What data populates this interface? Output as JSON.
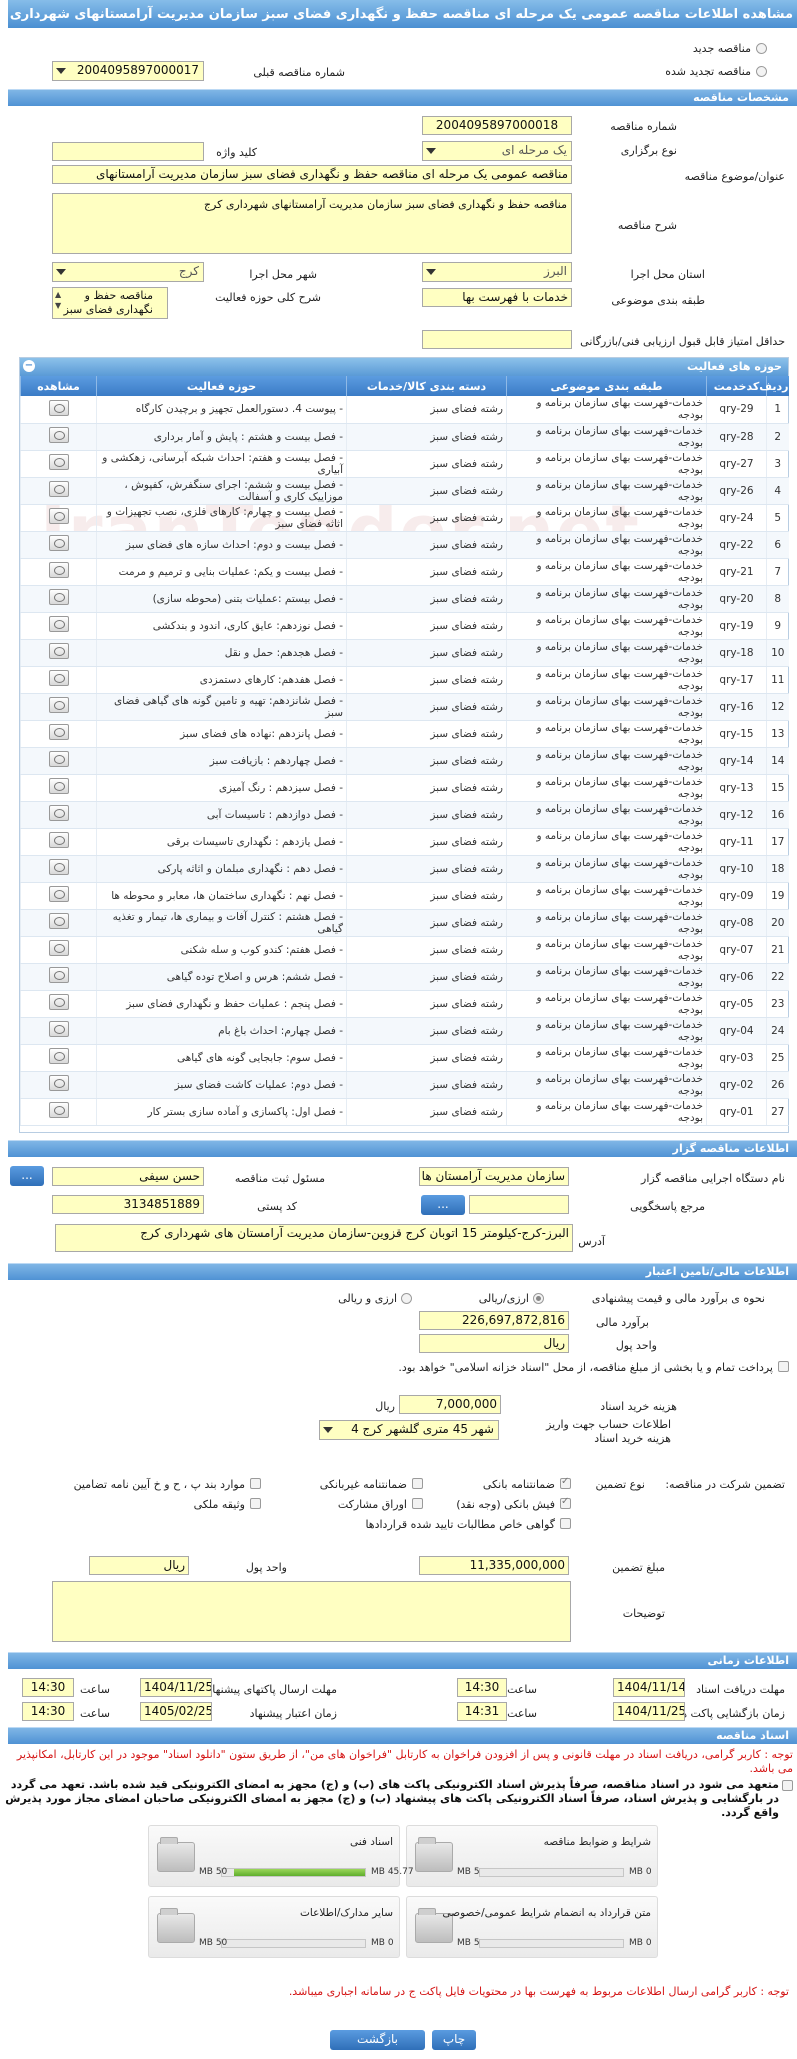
{
  "title": "مشاهده اطلاعات مناقصه عمومی یک مرحله ای مناقصه حفظ و نگهداری فضای سبز سازمان مدیریت آرامستانهای شهرداری کرج",
  "radios": {
    "new_label": "مناقصه جدید",
    "renew_label": "مناقصه تجدید شده",
    "prev_number_label": "شماره مناقصه قبلی",
    "prev_number": "2004095897000017"
  },
  "sections": {
    "specs": "مشخصات مناقصه",
    "activities": "حوزه های فعالیت",
    "organizer": "اطلاعات مناقصه گزار",
    "finance": "اطلاعات مالی/تامین اعتبار",
    "timing": "اطلاعات زمانی",
    "docs": "اسناد مناقصه"
  },
  "specs": {
    "number_label": "شماره مناقصه",
    "number": "2004095897000018",
    "type_label": "نوع برگزاری",
    "type": "یک مرحله ای",
    "keyword_label": "کلید واژه",
    "keyword": "",
    "subject_label": "عنوان/موضوع مناقصه",
    "subject": "مناقصه عمومی یک مرحله ای مناقصه حفظ و نگهداری فضای سبز سازمان مدیریت آرامستانهای",
    "desc_label": "شرح مناقصه",
    "desc": "مناقصه حفظ و نگهداری فضای سبز سازمان مدیریت آرامستانهای شهرداری کرج",
    "province_label": "استان محل اجرا",
    "province": "البرز",
    "city_label": "شهر محل اجرا",
    "city": "کرج",
    "category_label": "طبقه بندی موضوعی",
    "category": "خدمات با فهرست بها",
    "scope_label": "شرح کلی حوزه فعالیت",
    "scope": "مناقصه حفظ و نگهداری فضای سبز سازمان مدیریت",
    "min_score_label": "حداقل امتیاز قابل قبول ارزیابی فنی/بازرگانی",
    "min_score": ""
  },
  "table": {
    "headers": [
      "ردیف",
      "کدخدمت",
      "طبقه بندی موضوعی",
      "دسته بندی کالا/خدمات",
      "حوزه فعالیت",
      "مشاهده"
    ],
    "rows": [
      [
        "1",
        "qry-29",
        "خدمات-فهرست بهای سازمان برنامه و بودجه",
        "رشته فضای سبز",
        "- پیوست 4. دستورالعمل تجهیز و برچیدن کارگاه"
      ],
      [
        "2",
        "qry-28",
        "خدمات-فهرست بهای سازمان برنامه و بودجه",
        "رشته فضای سبز",
        "- فصل بیست و هشتم : پایش و آمار برداری"
      ],
      [
        "3",
        "qry-27",
        "خدمات-فهرست بهای سازمان برنامه و بودجه",
        "رشته فضای سبز",
        "- فصل بیست و هفتم: احداث شبکه آبرسانی، زهکشی و آبیاری"
      ],
      [
        "4",
        "qry-26",
        "خدمات-فهرست بهای سازمان برنامه و بودجه",
        "رشته فضای سبز",
        "- فصل بیست و ششم: اجرای سنگفرش، کفپوش ، موزاییک کاری و آسفالت"
      ],
      [
        "5",
        "qry-24",
        "خدمات-فهرست بهای سازمان برنامه و بودجه",
        "رشته فضای سبز",
        "- فصل بیست و چهارم: کارهای فلزی، نصب تجهیزات و اثاثه فضای سبز"
      ],
      [
        "6",
        "qry-22",
        "خدمات-فهرست بهای سازمان برنامه و بودجه",
        "رشته فضای سبز",
        "- فصل بیست و دوم: احداث سازه های فضای سبز"
      ],
      [
        "7",
        "qry-21",
        "خدمات-فهرست بهای سازمان برنامه و بودجه",
        "رشته فضای سبز",
        "- فصل بیست و یکم: عملیات بنایی و ترمیم و مرمت"
      ],
      [
        "8",
        "qry-20",
        "خدمات-فهرست بهای سازمان برنامه و بودجه",
        "رشته فضای سبز",
        "- فصل بیستم :عملیات بتنی (محوطه سازی)"
      ],
      [
        "9",
        "qry-19",
        "خدمات-فهرست بهای سازمان برنامه و بودجه",
        "رشته فضای سبز",
        "- فصل نوزدهم: عایق کاری، اندود و بندکشی"
      ],
      [
        "10",
        "qry-18",
        "خدمات-فهرست بهای سازمان برنامه و بودجه",
        "رشته فضای سبز",
        "- فصل هجدهم: حمل و نقل"
      ],
      [
        "11",
        "qry-17",
        "خدمات-فهرست بهای سازمان برنامه و بودجه",
        "رشته فضای سبز",
        "- فصل هفدهم: کارهای دستمزدی"
      ],
      [
        "12",
        "qry-16",
        "خدمات-فهرست بهای سازمان برنامه و بودجه",
        "رشته فضای سبز",
        "- فصل شانزدهم: تهیه و تامین گونه های گیاهی فضای سبز"
      ],
      [
        "13",
        "qry-15",
        "خدمات-فهرست بهای سازمان برنامه و بودجه",
        "رشته فضای سبز",
        "- فصل پانزدهم :نهاده های فضای سبز"
      ],
      [
        "14",
        "qry-14",
        "خدمات-فهرست بهای سازمان برنامه و بودجه",
        "رشته فضای سبز",
        "- فصل چهاردهم : بازیافت سبز"
      ],
      [
        "15",
        "qry-13",
        "خدمات-فهرست بهای سازمان برنامه و بودجه",
        "رشته فضای سبز",
        "- فصل سیزدهم : رنگ آمیزی"
      ],
      [
        "16",
        "qry-12",
        "خدمات-فهرست بهای سازمان برنامه و بودجه",
        "رشته فضای سبز",
        "- فصل دوازدهم : تاسیسات آبی"
      ],
      [
        "17",
        "qry-11",
        "خدمات-فهرست بهای سازمان برنامه و بودجه",
        "رشته فضای سبز",
        "- فصل یازدهم : نگهداری تاسیسات برقی"
      ],
      [
        "18",
        "qry-10",
        "خدمات-فهرست بهای سازمان برنامه و بودجه",
        "رشته فضای سبز",
        "- فصل دهم : نگهداری مبلمان و اثاثه پارکی"
      ],
      [
        "19",
        "qry-09",
        "خدمات-فهرست بهای سازمان برنامه و بودجه",
        "رشته فضای سبز",
        "- فصل نهم : نگهداری ساختمان ها، معابر و محوطه ها"
      ],
      [
        "20",
        "qry-08",
        "خدمات-فهرست بهای سازمان برنامه و بودجه",
        "رشته فضای سبز",
        "- فصل هشتم : کنترل آفات و بیماری ها، تیمار و تغذیه گیاهی"
      ],
      [
        "21",
        "qry-07",
        "خدمات-فهرست بهای سازمان برنامه و بودجه",
        "رشته فضای سبز",
        "- فصل هفتم: کندو کوب و سله شکنی"
      ],
      [
        "22",
        "qry-06",
        "خدمات-فهرست بهای سازمان برنامه و بودجه",
        "رشته فضای سبز",
        "- فصل ششم: هرس و اصلاح توده گیاهی"
      ],
      [
        "23",
        "qry-05",
        "خدمات-فهرست بهای سازمان برنامه و بودجه",
        "رشته فضای سبز",
        "- فصل پنجم : عملیات حفظ و نگهداری فضای سبز"
      ],
      [
        "24",
        "qry-04",
        "خدمات-فهرست بهای سازمان برنامه و بودجه",
        "رشته فضای سبز",
        "- فصل چهارم: احداث باغ بام"
      ],
      [
        "25",
        "qry-03",
        "خدمات-فهرست بهای سازمان برنامه و بودجه",
        "رشته فضای سبز",
        "- فصل سوم: جابجایی گونه های گیاهی"
      ],
      [
        "26",
        "qry-02",
        "خدمات-فهرست بهای سازمان برنامه و بودجه",
        "رشته فضای سبز",
        "- فصل دوم: عملیات کاشت فضای سبز"
      ],
      [
        "27",
        "qry-01",
        "خدمات-فهرست بهای سازمان برنامه و بودجه",
        "رشته فضای سبز",
        "- فصل اول: پاکسازی و آماده سازی بستر کار"
      ]
    ]
  },
  "organizer": {
    "org_label": "نام دستگاه اجرایی مناقصه گزار",
    "org": "سازمان مدیریت آرامستان ها",
    "official_label": "مسئول ثبت مناقصه",
    "official": "حسن سیفی",
    "ref_label": "مرجع پاسخگویی",
    "ref": "",
    "postal_label": "کد پستی",
    "postal": "3134851889",
    "address_label": "آدرس",
    "address": "البرز-کرج-کیلومتر 15 اتوبان کرج قزوین-سازمان مدیریت آرامستان های شهرداری کرج",
    "dots": "..."
  },
  "finance": {
    "estimate_type_label": "نحوه ی برآورد مالی و قیمت پیشنهادی",
    "rial_label": "ارزی/ریالی",
    "fx_label": "ارزی و ریالی",
    "budget_label": "برآورد مالی",
    "budget": "226,697,872,816",
    "unit_label": "واحد پول",
    "unit": "ریال",
    "treasury_label": "پرداخت تمام و یا بخشی از مبلغ مناقصه، از محل \"اسناد خزانه اسلامی\" خواهد بود.",
    "doc_fee_label": "هزینه خرید اسناد",
    "doc_fee": "7,000,000",
    "doc_fee_unit": "ریال",
    "account_label": "اطلاعات حساب جهت واریز هزینه خرید اسناد",
    "account": "شهر 45 متری گلشهر کرج 4",
    "participation_label": "تضمین شرکت در مناقصه:",
    "guarantee_type_label": "نوع تضمین",
    "options": [
      "ضمانتنامه بانکی",
      "ضمانتنامه غیربانکی",
      "موارد بند پ ، ح و خ آیین نامه تضامین",
      "فیش بانکی (وجه نقد)",
      "اوراق مشارکت",
      "وثیقه ملکی",
      "گواهی خاص مطالبات تایید شده قراردادها"
    ],
    "amount_label": "مبلغ تضمین",
    "amount": "11,335,000,000",
    "amount_unit_label": "واحد پول",
    "amount_unit": "ریال",
    "notes_label": "توضیحات",
    "notes": ""
  },
  "timing": {
    "recv_label": "مهلت دریافت اسناد",
    "recv_date": "1404/11/14",
    "recv_time": "14:30",
    "send_label": "مهلت ارسال پاکتهای پیشنهاد",
    "send_date": "1404/11/25",
    "send_time": "14:30",
    "open_label": "زمان بازگشایی پاکت ها",
    "open_date": "1404/11/25",
    "open_time": "14:31",
    "valid_label": "زمان اعتبار پیشنهاد",
    "valid_date": "1405/02/25",
    "valid_time": "14:30",
    "time_label": "ساعت"
  },
  "docs": {
    "notice1": "توجه : کاربر گرامی، دریافت اسناد در مهلت قانونی و پس از افزودن فراخوان به کارتابل \"فراخوان های من\"، از طریق ستون \"دانلود اسناد\" موجود در این کارتابل، امکانپذیر می باشد.",
    "notice2": "متعهد می شود در اسناد مناقصه، صرفاً پذیرش اسناد الکترونیکی پاکت های (ب) و (ج) مجهز به امضای الکترونیکی قید شده باشد. تعهد می گردد در بارگشایی و پذیرش اسناد، صرفاً اسناد الکترونیکی پاکت های پیشنهاد (ب) و (ج) مجهز به امضای الکترونیکی صاحبان امضای مجاز مورد پذیرش واقع گردد.",
    "boxes": [
      {
        "title": "شرایط و ضوابط مناقصه",
        "max": "5 MB",
        "current": "0 MB",
        "pct": 0
      },
      {
        "title": "اسناد فنی",
        "max": "50 MB",
        "current": "45.77 MB",
        "pct": 0.915
      },
      {
        "title": "متن قرارداد به انضمام شرایط عمومی/خصوصی",
        "max": "5 MB",
        "current": "0 MB",
        "pct": 0
      },
      {
        "title": "سایر مدارک/اطلاعات",
        "max": "50 MB",
        "current": "0 MB",
        "pct": 0
      }
    ],
    "notice3": "توجه : کاربر گرامی ارسال اطلاعات مربوط به فهرست بها در محتویات فایل پاکت ج در سامانه اجباری میباشد."
  },
  "buttons": {
    "print": "چاپ",
    "back": "بازگشت"
  },
  "watermark": "IranTender.net"
}
